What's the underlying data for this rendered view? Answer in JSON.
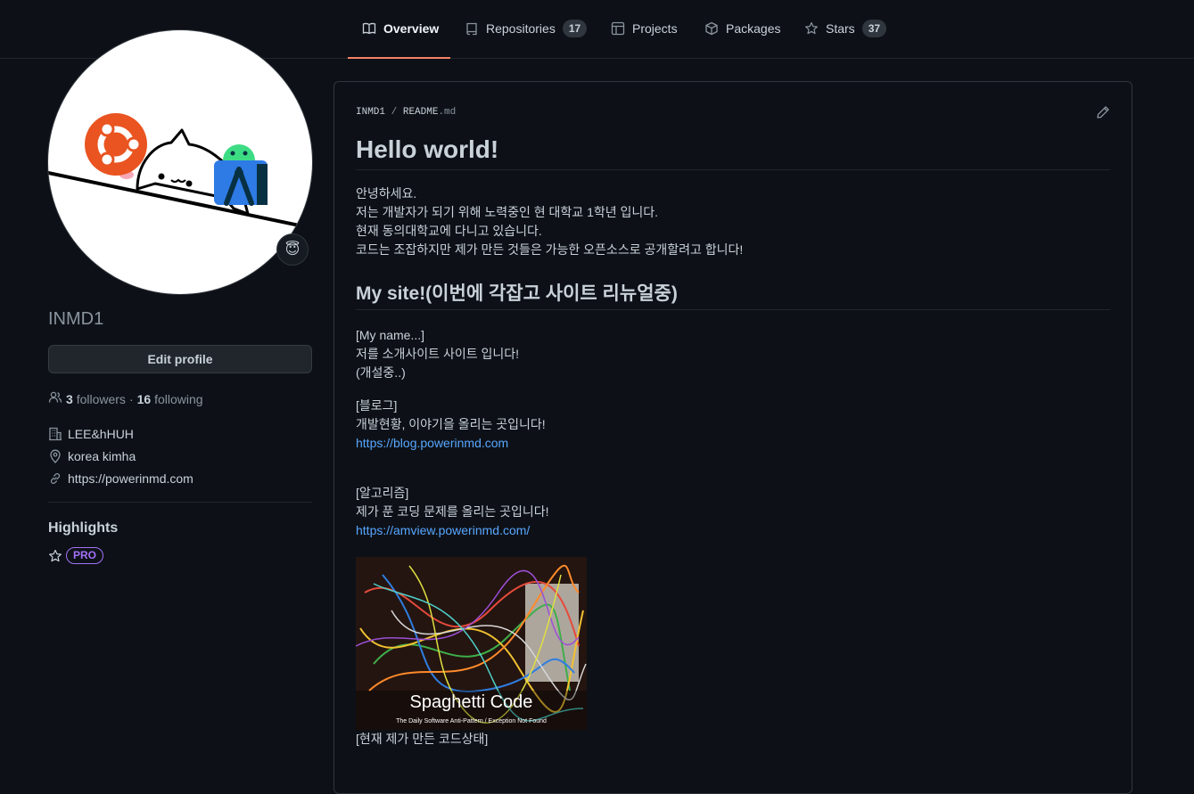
{
  "nav": {
    "tabs": [
      {
        "label": "Overview",
        "icon": "book-icon",
        "active": true
      },
      {
        "label": "Repositories",
        "icon": "repo-icon",
        "count": "17"
      },
      {
        "label": "Projects",
        "icon": "project-icon"
      },
      {
        "label": "Packages",
        "icon": "package-icon"
      },
      {
        "label": "Stars",
        "icon": "star-icon",
        "count": "37"
      }
    ]
  },
  "profile": {
    "status_emoji": "😇",
    "username": "INMD1",
    "edit_label": "Edit profile",
    "followers_count": "3",
    "followers_label": "followers",
    "dot": "·",
    "following_count": "16",
    "following_label": "following",
    "organization": "LEE&hHUH",
    "location": "korea kimha",
    "website": "https://powerinmd.com",
    "highlights_title": "Highlights",
    "pro_badge": "PRO"
  },
  "readme": {
    "owner": "INMD1",
    "slash": "/",
    "file_name": "README",
    "file_ext": ".md",
    "title": "Hello world!",
    "intro": [
      "안녕하세요.",
      "저는 개발자가 되기 위해 노력중인 현 대학교 1학년 입니다.",
      "현재 동의대학교에 다니고 있습니다.",
      "코드는 조잡하지만 제가 만든 것들은 가능한 오픈소스로 공개할려고 합니다!"
    ],
    "site_heading": "My site!(이번에 각잡고 사이트 리뉴얼중)",
    "myname": [
      "[My name...]",
      "저를 소개사이트 사이트 입니다!",
      "(개설중..)"
    ],
    "blog": [
      "[블로그]",
      "개발현황, 이야기을 올리는 곳입니다!"
    ],
    "blog_link": "https://blog.powerinmd.com",
    "algo": [
      "[알고리즘]",
      "제가 푼 코딩 문제를 올리는 곳입니다!"
    ],
    "algo_link": "https://amview.powerinmd.com/",
    "image_caption": "Spaghetti Code",
    "image_subcaption": "The Daily Software Anti-Pattern / Exception Not Found",
    "image_note": "[현재 제가 만든 코드상태]"
  }
}
